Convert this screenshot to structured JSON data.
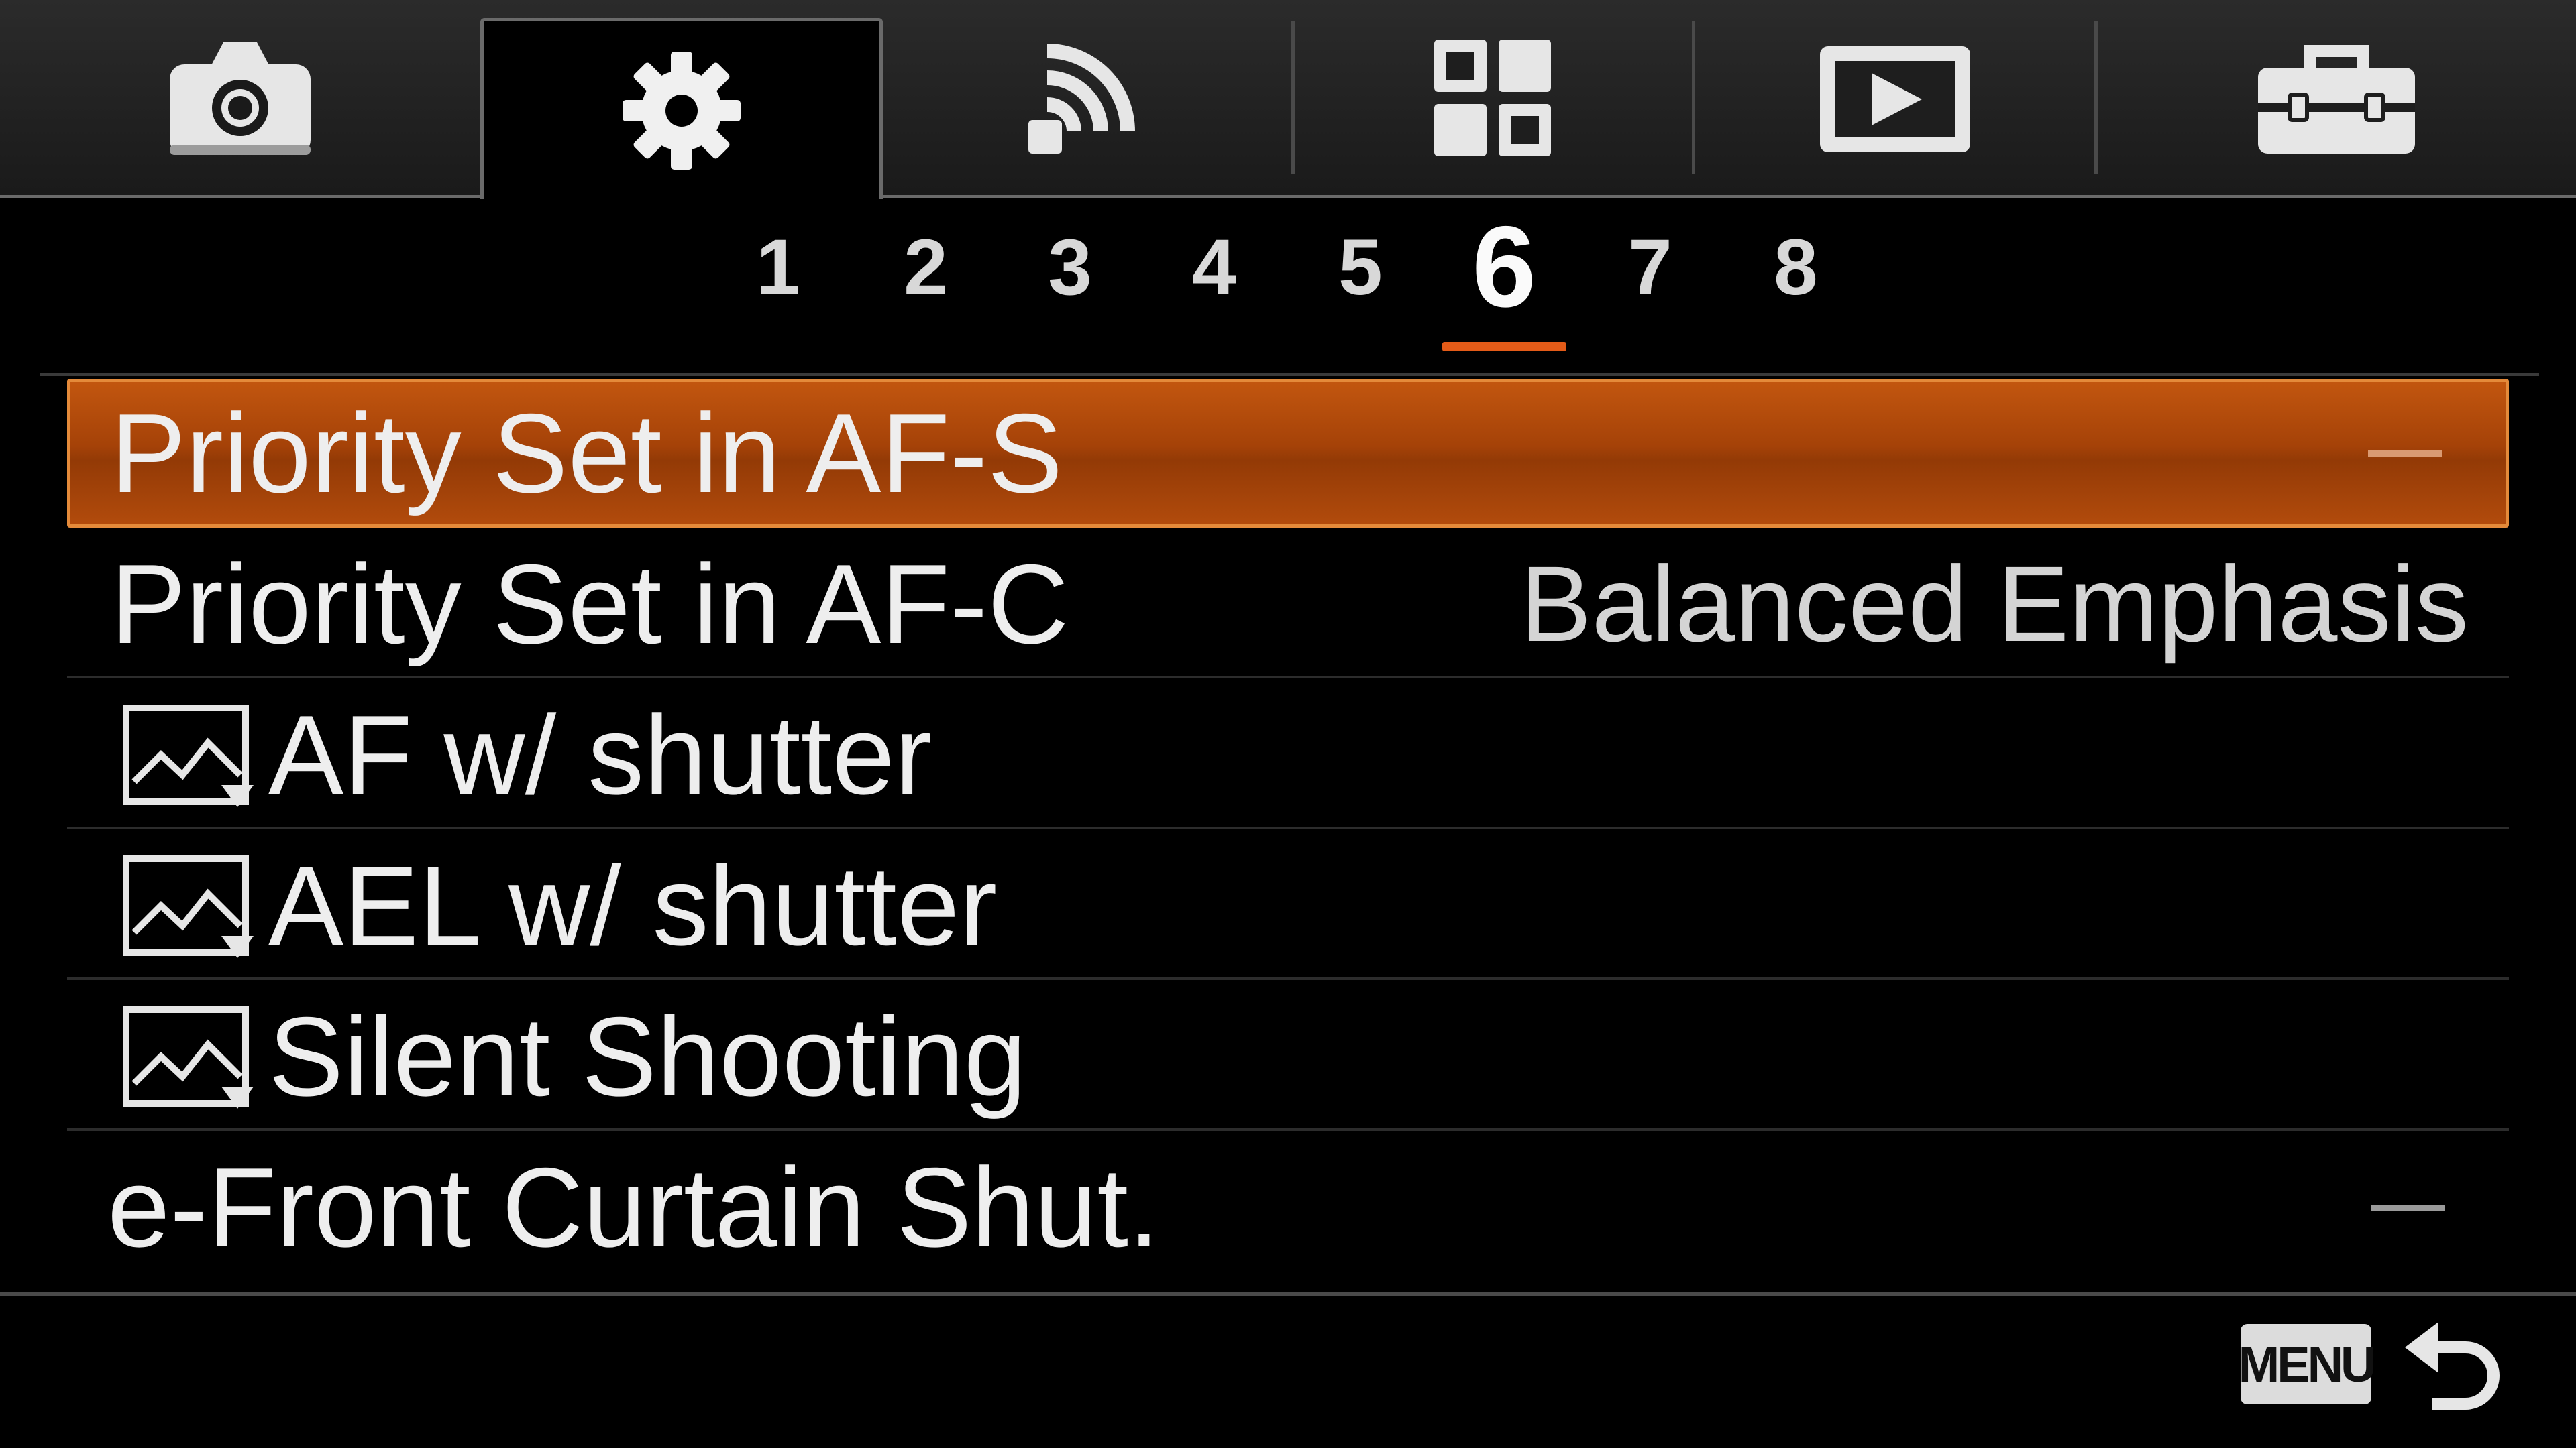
{
  "tabs": [
    {
      "icon": "camera-icon"
    },
    {
      "icon": "gear-icon",
      "selected": true
    },
    {
      "icon": "wireless-icon"
    },
    {
      "icon": "apps-grid-icon"
    },
    {
      "icon": "playback-icon"
    },
    {
      "icon": "toolbox-icon"
    }
  ],
  "pages": {
    "items": [
      "1",
      "2",
      "3",
      "4",
      "5",
      "6",
      "7",
      "8"
    ],
    "active": "6"
  },
  "menu": {
    "items": [
      {
        "label": "Priority Set in AF-S",
        "value": "—",
        "selected": true
      },
      {
        "label": "Priority Set in AF-C",
        "value": "Balanced Emphasis"
      },
      {
        "label": "AF w/ shutter",
        "icon": "still-image-icon"
      },
      {
        "label": "AEL w/ shutter",
        "icon": "still-image-icon"
      },
      {
        "label": "Silent Shooting",
        "icon": "still-image-icon"
      },
      {
        "label": "e-Front Curtain Shut.",
        "value": "—"
      }
    ]
  },
  "footer": {
    "menu_label": "MENU",
    "back_icon": "return-arrow-icon"
  },
  "colors": {
    "accent": "#e35b18",
    "selection": "#a54208",
    "background": "#000000"
  }
}
